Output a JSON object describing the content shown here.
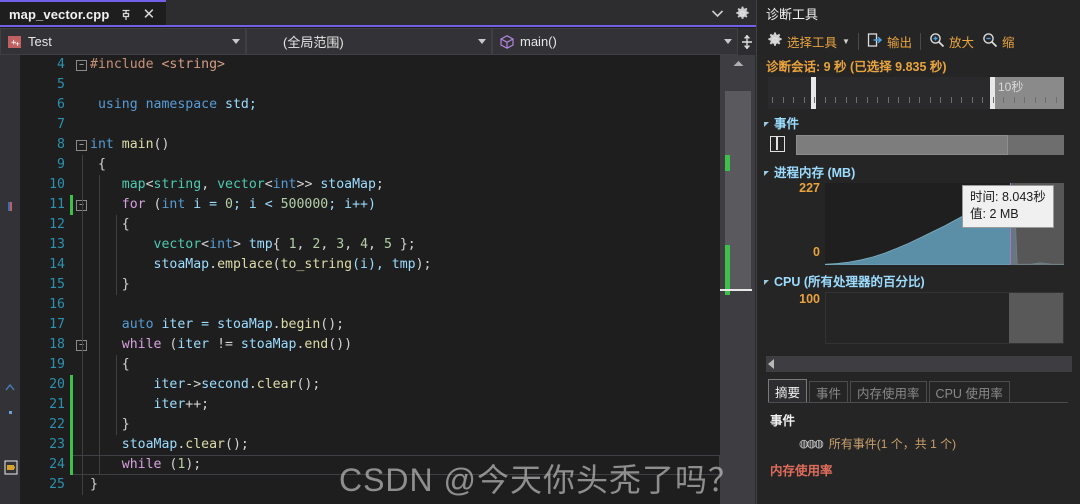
{
  "editor": {
    "tab": {
      "title": "map_vector.cpp",
      "pin_icon": "pin-icon",
      "close_icon": "close-icon"
    },
    "tabstrip": {
      "dropdown_icon": "chevron-down-icon",
      "settings_icon": "gear-icon"
    },
    "navbar": {
      "project": {
        "label": "Test",
        "icon": "cpp-project-icon",
        "arrow": "chevron-down-icon"
      },
      "scope": {
        "label": "(全局范围)",
        "arrow": "chevron-down-icon"
      },
      "symbol": {
        "label": "main()",
        "icon": "cube-icon",
        "arrow": "chevron-down-icon"
      },
      "split_icon": "split-view-icon"
    },
    "lines": [
      {
        "n": "4",
        "fold": "-",
        "change": "none",
        "tokens": [
          {
            "t": "#include ",
            "c": "k-pre"
          },
          {
            "t": "<string>",
            "c": "k-str"
          }
        ]
      },
      {
        "n": "5",
        "fold": "",
        "change": "none",
        "tokens": []
      },
      {
        "n": "6",
        "fold": "",
        "change": "none",
        "tokens": [
          {
            "t": " ",
            "c": "k-op"
          },
          {
            "t": "using",
            "c": "k-kw"
          },
          {
            "t": " ",
            "c": "k-op"
          },
          {
            "t": "namespace",
            "c": "k-kw"
          },
          {
            "t": " std;",
            "c": "k-var"
          }
        ]
      },
      {
        "n": "7",
        "fold": "",
        "change": "none",
        "tokens": []
      },
      {
        "n": "8",
        "fold": "-",
        "change": "none",
        "tokens": [
          {
            "t": "int",
            "c": "k-kw"
          },
          {
            "t": " ",
            "c": "k-op"
          },
          {
            "t": "main",
            "c": "k-fn"
          },
          {
            "t": "()",
            "c": "k-op"
          }
        ]
      },
      {
        "n": "9",
        "fold": "",
        "change": "none",
        "tokens": [
          {
            "t": " {",
            "c": "k-brc"
          }
        ]
      },
      {
        "n": "10",
        "fold": "",
        "change": "none",
        "tokens": [
          {
            "t": "    ",
            "c": "k-op"
          },
          {
            "t": "map",
            "c": "k-type"
          },
          {
            "t": "<",
            "c": "k-op"
          },
          {
            "t": "string",
            "c": "k-type"
          },
          {
            "t": ", ",
            "c": "k-op"
          },
          {
            "t": "vector",
            "c": "k-type"
          },
          {
            "t": "<",
            "c": "k-op"
          },
          {
            "t": "int",
            "c": "k-kw"
          },
          {
            "t": ">> ",
            "c": "k-op"
          },
          {
            "t": "stoaMap",
            "c": "k-var"
          },
          {
            "t": ";",
            "c": "k-op"
          }
        ]
      },
      {
        "n": "11",
        "fold": "-",
        "change": "green",
        "tokens": [
          {
            "t": "    ",
            "c": "k-op"
          },
          {
            "t": "for",
            "c": "k-ctl"
          },
          {
            "t": " (",
            "c": "k-op"
          },
          {
            "t": "int",
            "c": "k-kw"
          },
          {
            "t": " i = ",
            "c": "k-var"
          },
          {
            "t": "0",
            "c": "k-num"
          },
          {
            "t": "; i < ",
            "c": "k-var"
          },
          {
            "t": "500000",
            "c": "k-num"
          },
          {
            "t": "; i++)",
            "c": "k-var"
          }
        ]
      },
      {
        "n": "12",
        "fold": "",
        "change": "none",
        "tokens": [
          {
            "t": "    {",
            "c": "k-brc"
          }
        ]
      },
      {
        "n": "13",
        "fold": "",
        "change": "none",
        "tokens": [
          {
            "t": "        ",
            "c": "k-op"
          },
          {
            "t": "vector",
            "c": "k-type"
          },
          {
            "t": "<",
            "c": "k-op"
          },
          {
            "t": "int",
            "c": "k-kw"
          },
          {
            "t": "> ",
            "c": "k-op"
          },
          {
            "t": "tmp",
            "c": "k-var"
          },
          {
            "t": "{ ",
            "c": "k-brc"
          },
          {
            "t": "1",
            "c": "k-num"
          },
          {
            "t": ", ",
            "c": "k-op"
          },
          {
            "t": "2",
            "c": "k-num"
          },
          {
            "t": ", ",
            "c": "k-op"
          },
          {
            "t": "3",
            "c": "k-num"
          },
          {
            "t": ", ",
            "c": "k-op"
          },
          {
            "t": "4",
            "c": "k-num"
          },
          {
            "t": ", ",
            "c": "k-op"
          },
          {
            "t": "5",
            "c": "k-num"
          },
          {
            "t": " };",
            "c": "k-brc"
          }
        ]
      },
      {
        "n": "14",
        "fold": "",
        "change": "none",
        "tokens": [
          {
            "t": "        ",
            "c": "k-op"
          },
          {
            "t": "stoaMap",
            "c": "k-var"
          },
          {
            "t": ".",
            "c": "k-op"
          },
          {
            "t": "emplace",
            "c": "k-fn"
          },
          {
            "t": "(",
            "c": "k-op"
          },
          {
            "t": "to_string",
            "c": "k-fn"
          },
          {
            "t": "(i), ",
            "c": "k-var"
          },
          {
            "t": "tmp",
            "c": "k-var"
          },
          {
            "t": ");",
            "c": "k-op"
          }
        ]
      },
      {
        "n": "15",
        "fold": "",
        "change": "none",
        "tokens": [
          {
            "t": "    }",
            "c": "k-brc"
          }
        ]
      },
      {
        "n": "16",
        "fold": "",
        "change": "none",
        "tokens": []
      },
      {
        "n": "17",
        "fold": "",
        "change": "none",
        "tokens": [
          {
            "t": "    ",
            "c": "k-op"
          },
          {
            "t": "auto",
            "c": "k-kw"
          },
          {
            "t": " iter = ",
            "c": "k-var"
          },
          {
            "t": "stoaMap",
            "c": "k-var"
          },
          {
            "t": ".",
            "c": "k-op"
          },
          {
            "t": "begin",
            "c": "k-fn"
          },
          {
            "t": "();",
            "c": "k-op"
          }
        ]
      },
      {
        "n": "18",
        "fold": "-",
        "change": "none",
        "tokens": [
          {
            "t": "    ",
            "c": "k-op"
          },
          {
            "t": "while",
            "c": "k-ctl"
          },
          {
            "t": " (",
            "c": "k-op"
          },
          {
            "t": "iter",
            "c": "k-var"
          },
          {
            "t": " != ",
            "c": "k-op"
          },
          {
            "t": "stoaMap",
            "c": "k-var"
          },
          {
            "t": ".",
            "c": "k-op"
          },
          {
            "t": "end",
            "c": "k-fn"
          },
          {
            "t": "())",
            "c": "k-op"
          }
        ]
      },
      {
        "n": "19",
        "fold": "",
        "change": "none",
        "tokens": [
          {
            "t": "    {",
            "c": "k-brc"
          }
        ]
      },
      {
        "n": "20",
        "fold": "",
        "change": "green",
        "tokens": [
          {
            "t": "        ",
            "c": "k-op"
          },
          {
            "t": "iter",
            "c": "k-var"
          },
          {
            "t": "->",
            "c": "k-op"
          },
          {
            "t": "second",
            "c": "k-var"
          },
          {
            "t": ".",
            "c": "k-op"
          },
          {
            "t": "clear",
            "c": "k-fn"
          },
          {
            "t": "();",
            "c": "k-op"
          }
        ]
      },
      {
        "n": "21",
        "fold": "",
        "change": "green",
        "tokens": [
          {
            "t": "        ",
            "c": "k-op"
          },
          {
            "t": "iter",
            "c": "k-var"
          },
          {
            "t": "++;",
            "c": "k-op"
          }
        ]
      },
      {
        "n": "22",
        "fold": "",
        "change": "green",
        "tokens": [
          {
            "t": "    }",
            "c": "k-brc"
          }
        ]
      },
      {
        "n": "23",
        "fold": "",
        "change": "green",
        "tokens": [
          {
            "t": "    ",
            "c": "k-op"
          },
          {
            "t": "stoaMap",
            "c": "k-var"
          },
          {
            "t": ".",
            "c": "k-op"
          },
          {
            "t": "clear",
            "c": "k-fn"
          },
          {
            "t": "();",
            "c": "k-op"
          }
        ]
      },
      {
        "n": "24",
        "fold": "",
        "change": "green",
        "tokens": [
          {
            "t": "    ",
            "c": "k-op"
          },
          {
            "t": "while",
            "c": "k-ctl"
          },
          {
            "t": " (",
            "c": "k-op"
          },
          {
            "t": "1",
            "c": "k-num"
          },
          {
            "t": ");",
            "c": "k-op"
          }
        ]
      },
      {
        "n": "25",
        "fold": "",
        "change": "none",
        "tokens": [
          {
            "t": "}",
            "c": "k-brc"
          }
        ]
      }
    ],
    "scrollbar": {
      "up_arrow_icon": "scroll-up-icon"
    }
  },
  "diagnostics": {
    "title": "诊断工具",
    "toolbar": {
      "select_tools": {
        "label": "选择工具",
        "icon": "gear-icon",
        "caret": "▼"
      },
      "output": {
        "label": "输出",
        "icon": "output-icon"
      },
      "zoom_in": {
        "label": "放大",
        "icon": "zoom-in-icon"
      },
      "zoom_out": {
        "label": "缩",
        "icon": "zoom-out-icon"
      }
    },
    "session_text": "诊断会话: 9 秒 (已选择 9.835 秒)",
    "timeline": {
      "end_label": "10秒"
    },
    "sections": {
      "events": {
        "title": "事件",
        "marker_icon": "pause-marker-icon"
      },
      "memory": {
        "title": "进程内存 (MB)",
        "y_max": "227",
        "y_min": "0"
      },
      "cpu": {
        "title": "CPU (所有处理器的百分比)",
        "y_max": "100"
      }
    },
    "tooltip": {
      "time": "时间: 8.043秒",
      "value": "值: 2 MB"
    },
    "tabs": [
      {
        "label": "摘要",
        "selected": true
      },
      {
        "label": "事件",
        "selected": false
      },
      {
        "label": "内存使用率",
        "selected": false
      },
      {
        "label": "CPU 使用率",
        "selected": false
      }
    ],
    "summary": {
      "heading": "事件",
      "all_events": "所有事件(1 个，共 1 个)",
      "memory_usage": "内存使用率"
    }
  },
  "watermark": {
    "text": "CSDN @今天你头秃了吗？"
  },
  "chart_data": [
    {
      "type": "area",
      "title": "进程内存 (MB)",
      "xlabel": "",
      "ylabel": "MB",
      "ylim": [
        0,
        227
      ],
      "xlim": [
        0,
        10
      ],
      "grid": false,
      "legend": "none",
      "x": [
        0,
        0.5,
        1.0,
        1.5,
        2.0,
        2.5,
        3.0,
        3.5,
        4.0,
        4.5,
        5.0,
        5.5,
        6.0,
        6.5,
        7.0,
        7.3,
        7.5,
        7.7,
        7.9,
        8.043,
        8.2,
        8.4,
        8.6,
        9.0,
        9.5,
        10.0
      ],
      "values": [
        2,
        4,
        8,
        14,
        22,
        33,
        46,
        60,
        76,
        92,
        108,
        126,
        144,
        162,
        180,
        196,
        206,
        214,
        218,
        2,
        2,
        2,
        2,
        6,
        2,
        2
      ],
      "annotations": [
        "时间: 8.043秒",
        "值: 2 MB"
      ]
    },
    {
      "type": "line",
      "title": "CPU (所有处理器的百分比)",
      "xlabel": "",
      "ylabel": "%",
      "ylim": [
        0,
        100
      ],
      "xlim": [
        0,
        10
      ],
      "grid": false,
      "legend": "none",
      "x": [
        0,
        2,
        4,
        6,
        8,
        10
      ],
      "values": [
        0,
        0,
        0,
        0,
        0,
        0
      ]
    }
  ]
}
